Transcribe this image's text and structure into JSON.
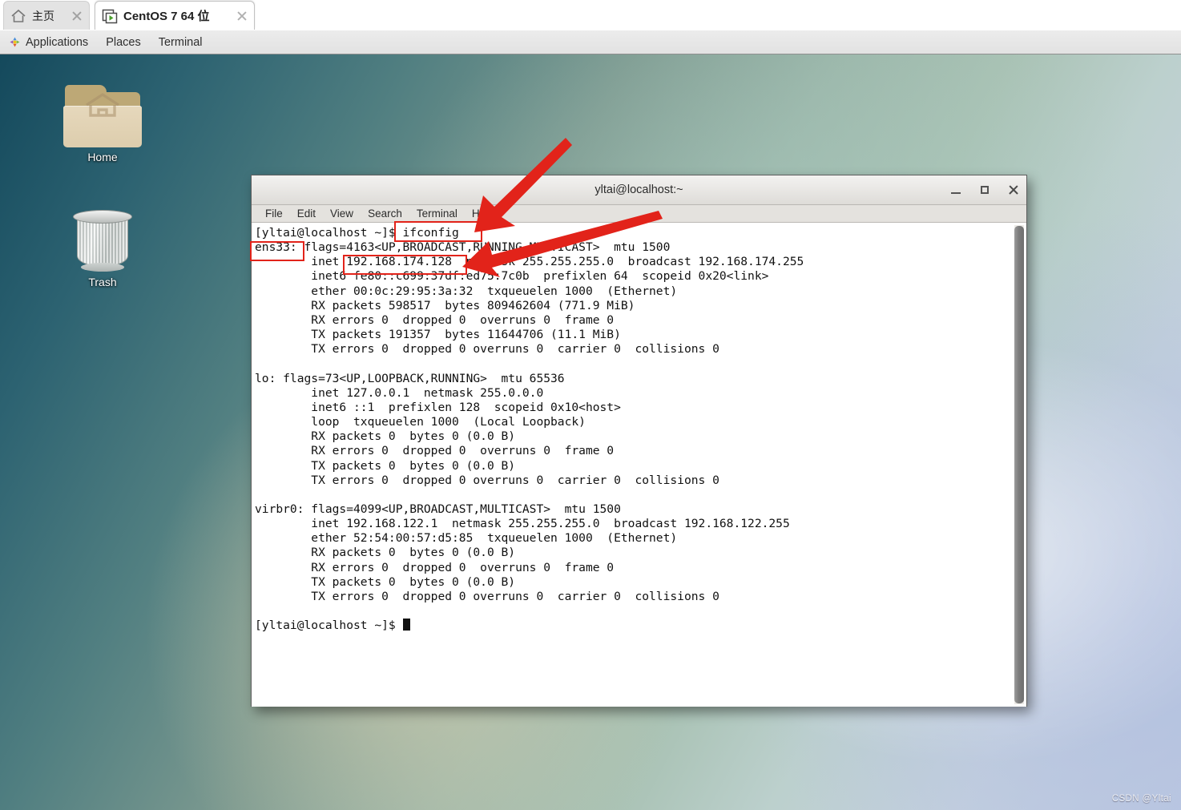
{
  "tabs": [
    {
      "label": "主页",
      "icon": "home-icon",
      "active": false
    },
    {
      "label": "CentOS 7 64 位",
      "icon": "vm-play-icon",
      "active": true
    }
  ],
  "panel": {
    "applications": "Applications",
    "places": "Places",
    "terminal": "Terminal"
  },
  "desktop": {
    "icons": [
      {
        "label": "Home",
        "icon": "folder-home-icon"
      },
      {
        "label": "Trash",
        "icon": "trash-can-icon"
      }
    ],
    "watermark": "CSDN @Yltai"
  },
  "terminal": {
    "title": "yltai@localhost:~",
    "menu": [
      "File",
      "Edit",
      "View",
      "Search",
      "Terminal",
      "Help"
    ],
    "window_buttons": [
      "minimize",
      "maximize",
      "close"
    ],
    "prompt": "[yltai@localhost ~]$",
    "command": "ifconfig",
    "output": "[yltai@localhost ~]$ ifconfig\nens33: flags=4163<UP,BROADCAST,RUNNING,MULTICAST>  mtu 1500\n        inet 192.168.174.128  netmask 255.255.255.0  broadcast 192.168.174.255\n        inet6 fe80::c699:37df:ed75:7c0b  prefixlen 64  scopeid 0x20<link>\n        ether 00:0c:29:95:3a:32  txqueuelen 1000  (Ethernet)\n        RX packets 598517  bytes 809462604 (771.9 MiB)\n        RX errors 0  dropped 0  overruns 0  frame 0\n        TX packets 191357  bytes 11644706 (11.1 MiB)\n        TX errors 0  dropped 0 overruns 0  carrier 0  collisions 0\n\nlo: flags=73<UP,LOOPBACK,RUNNING>  mtu 65536\n        inet 127.0.0.1  netmask 255.0.0.0\n        inet6 ::1  prefixlen 128  scopeid 0x10<host>\n        loop  txqueuelen 1000  (Local Loopback)\n        RX packets 0  bytes 0 (0.0 B)\n        RX errors 0  dropped 0  overruns 0  frame 0\n        TX packets 0  bytes 0 (0.0 B)\n        TX errors 0  dropped 0 overruns 0  carrier 0  collisions 0\n\nvirbr0: flags=4099<UP,BROADCAST,MULTICAST>  mtu 1500\n        inet 192.168.122.1  netmask 255.255.255.0  broadcast 192.168.122.255\n        ether 52:54:00:57:d5:85  txqueuelen 1000  (Ethernet)\n        RX packets 0  bytes 0 (0.0 B)\n        RX errors 0  dropped 0  overruns 0  frame 0\n        TX packets 0  bytes 0 (0.0 B)\n        TX errors 0  dropped 0 overruns 0  carrier 0  collisions 0\n\n",
    "final_prompt": "[yltai@localhost ~]$ "
  },
  "annotations": {
    "color": "#e2231a",
    "highlighted": [
      "ifconfig",
      "ens33:",
      "192.168.174.128"
    ],
    "arrows": 2
  }
}
